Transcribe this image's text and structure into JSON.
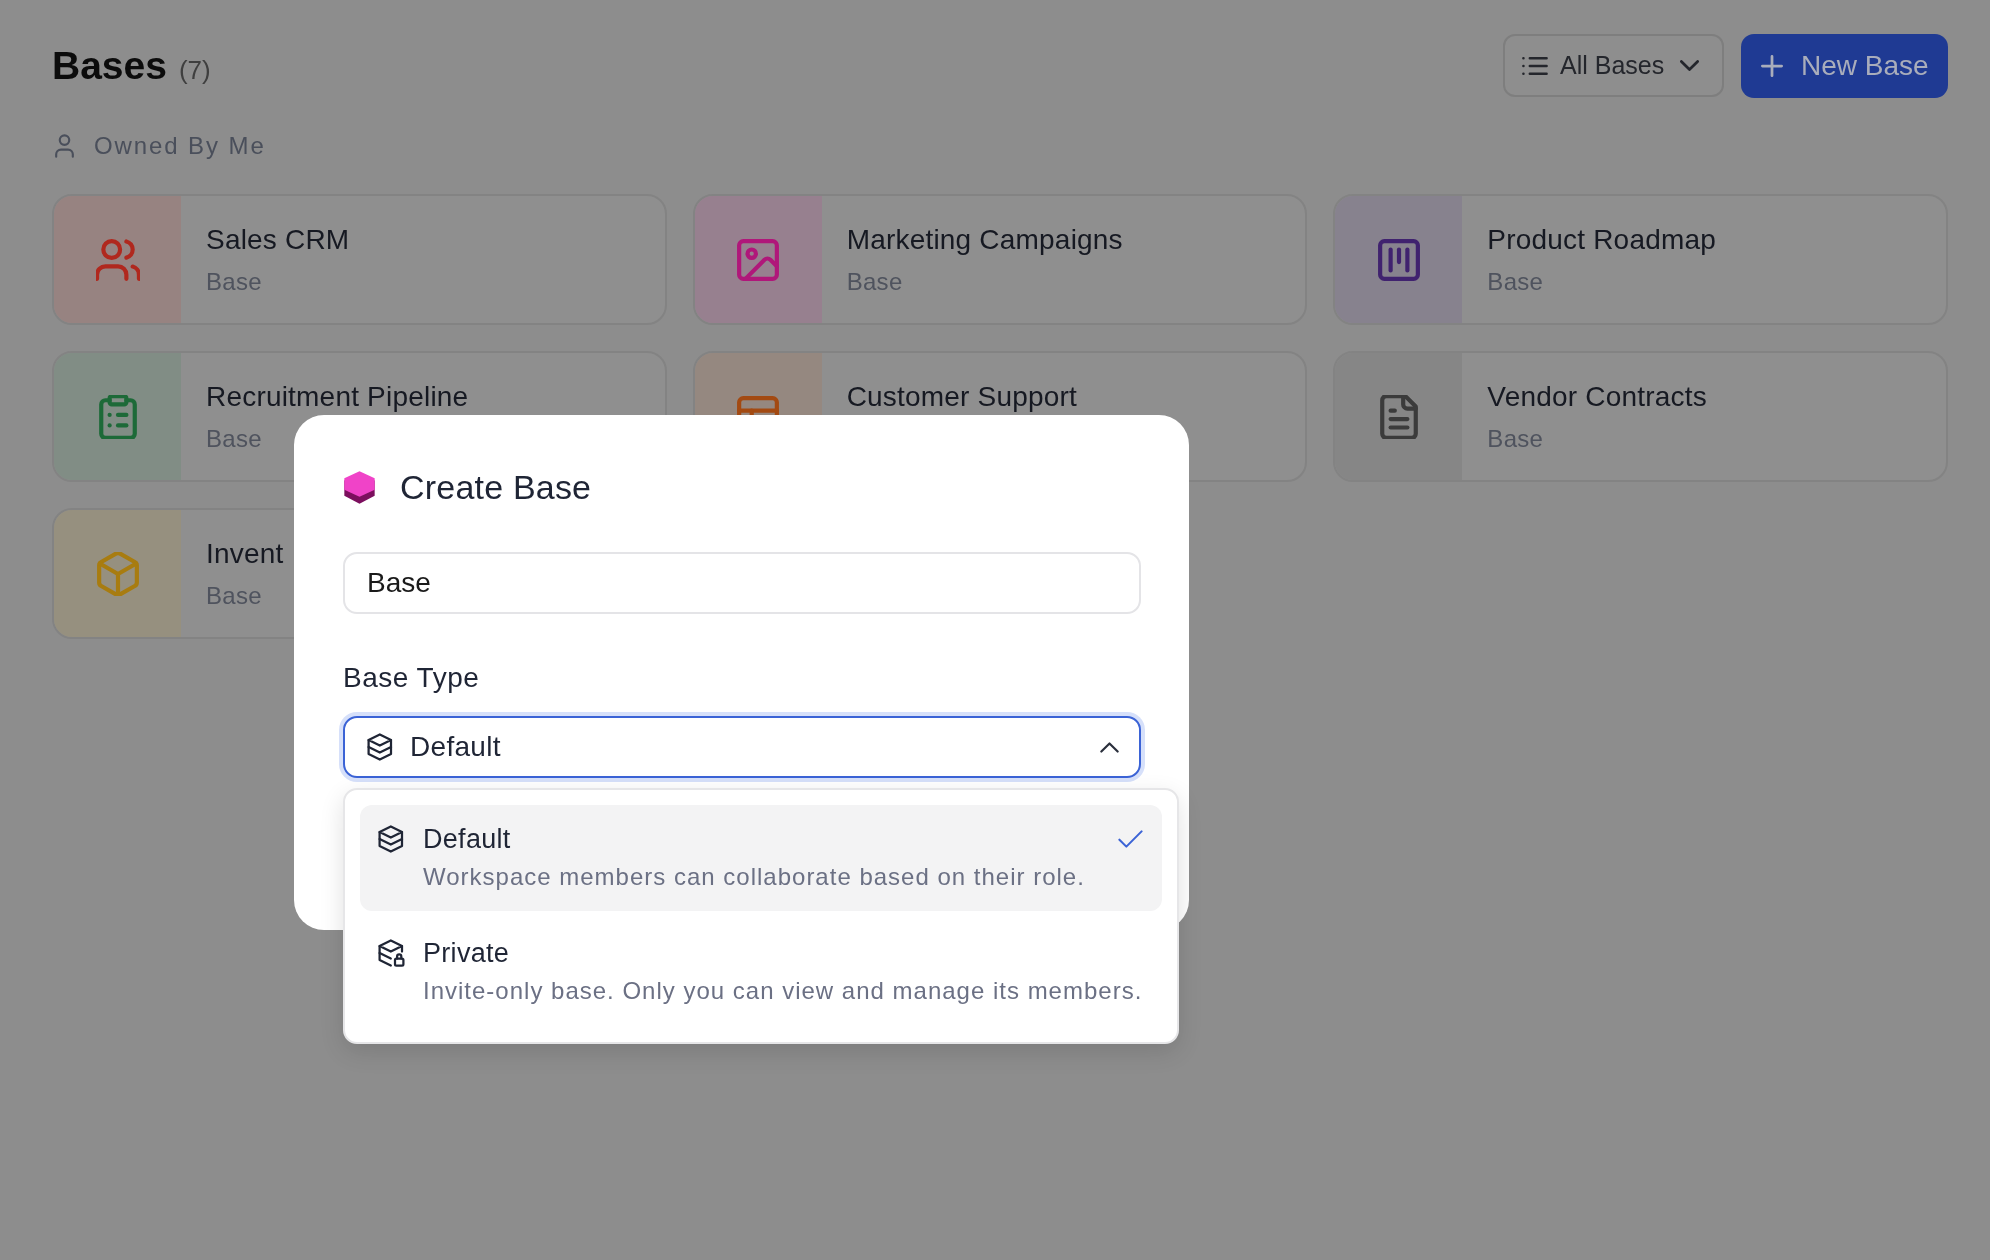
{
  "header": {
    "title": "Bases",
    "count": "(7)",
    "filter_button": {
      "label": "All Bases"
    },
    "new_button": {
      "label": "New Base"
    }
  },
  "section": {
    "label": "Owned By Me"
  },
  "bases": [
    {
      "name": "Sales CRM",
      "subtitle": "Base",
      "kind": "users",
      "color": "#b0281e"
    },
    {
      "name": "Marketing Campaigns",
      "subtitle": "Base",
      "kind": "image",
      "color": "#b0177a"
    },
    {
      "name": "Product Roadmap",
      "subtitle": "Base",
      "kind": "board",
      "color": "#40226f"
    },
    {
      "name": "Recruitment Pipeline",
      "subtitle": "Base",
      "kind": "clipboard",
      "color": "#1d6a38"
    },
    {
      "name": "Customer Support",
      "kind": "layout",
      "color": "#a34a12"
    },
    {
      "name": "Vendor Contracts",
      "subtitle": "Base",
      "kind": "document",
      "color": "#3b3b3b"
    },
    {
      "name": "Invent",
      "subtitle": "Base",
      "kind": "box",
      "color": "#a87c10"
    }
  ],
  "dialog": {
    "title": "Create Base",
    "name_field": {
      "value": "Base"
    },
    "type_label": "Base Type",
    "type_select": {
      "value": "Default",
      "expanded": true
    },
    "options": [
      {
        "title": "Default",
        "description": "Workspace members can collaborate based on their role.",
        "kind": "shared",
        "selected": true
      },
      {
        "title": "Private",
        "description": "Invite-only base. Only you can view and manage its members.",
        "kind": "private",
        "selected": false
      }
    ]
  }
}
